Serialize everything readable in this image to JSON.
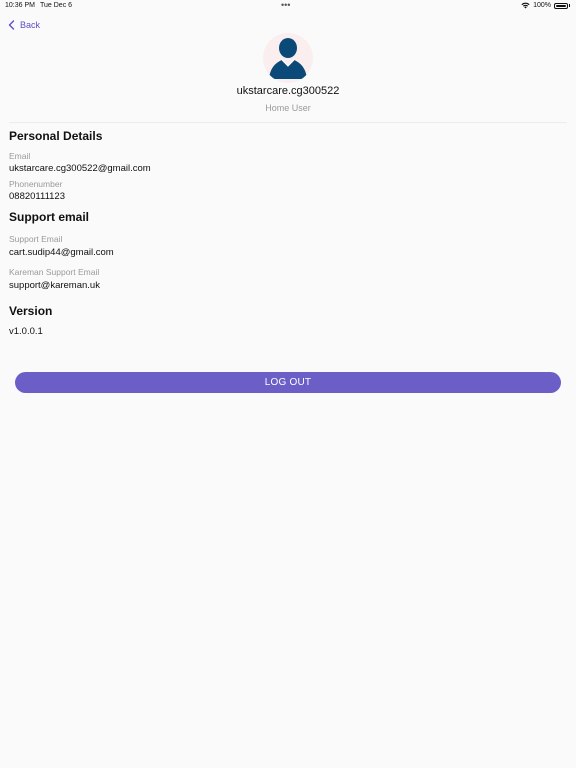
{
  "status_bar": {
    "time": "10:36 PM",
    "date": "Tue Dec 6",
    "battery": "100%"
  },
  "nav": {
    "back_label": "Back"
  },
  "profile": {
    "username": "ukstarcare.cg300522",
    "role": "Home User"
  },
  "personal_details": {
    "title": "Personal Details",
    "email_label": "Email",
    "email_value": "ukstarcare.cg300522@gmail.com",
    "phone_label": "Phonenumber",
    "phone_value": "08820111123"
  },
  "support": {
    "title": "Support email",
    "support_label": "Support Email",
    "support_value": "cart.sudip44@gmail.com",
    "kareman_label": "Kareman Support Email",
    "kareman_value": "support@kareman.uk"
  },
  "version": {
    "title": "Version",
    "value": "v1.0.0.1"
  },
  "actions": {
    "logout_label": "LOG OUT"
  },
  "colors": {
    "accent": "#6b5fc7",
    "avatar": "#0b4a78",
    "avatar_bg": "#fbeeee"
  }
}
